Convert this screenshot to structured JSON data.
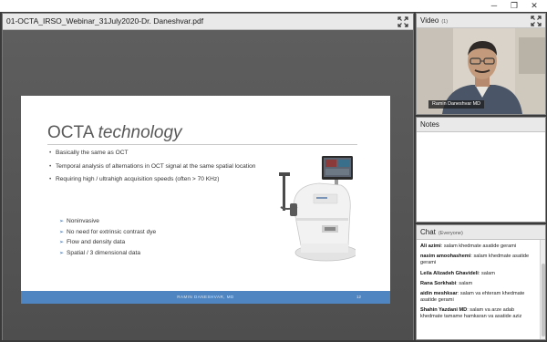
{
  "window": {
    "min_glyph": "─",
    "max_glyph": "❐",
    "close_glyph": "✕"
  },
  "document": {
    "title": "01-OCTA_IRSO_Webinar_31July2020-Dr. Daneshvar.pdf",
    "slide": {
      "title_plain": "OCTA ",
      "title_italic": "technology",
      "bullets": [
        "Basically the same as OCT",
        "Temporal analysis of alternations in OCT signal at the same spatial location",
        "Requiring high / ultrahigh acquisition speeds (often > 70 KHz)"
      ],
      "sub_bullets": [
        "Noninvasive",
        "No need for extrinsic contrast dye",
        "Flow and density data",
        "Spatial / 3 dimensional data"
      ],
      "footer_text": "RAMIN DANESHVAR, MD",
      "page_number": "12"
    }
  },
  "video": {
    "title": "Video",
    "count": "(1)",
    "speaker_name": "Ramin Daneshvar MD"
  },
  "notes": {
    "title": "Notes"
  },
  "chat": {
    "title": "Chat",
    "scope": "(Everyone)",
    "messages": [
      {
        "sender": "Ali azimi",
        "text": "salam khedmate asatide gerami"
      },
      {
        "sender": "nasim amoohashemi",
        "text": "salam khedmate asatide gerami"
      },
      {
        "sender": "Leila Alizadeh Ghavideli",
        "text": "salam"
      },
      {
        "sender": "Rana Sorkhabi",
        "text": "salam"
      },
      {
        "sender": "aidin meshksar",
        "text": "salam va ehteram khedmate asatide gerami"
      },
      {
        "sender": "Shahin Yazdani MD",
        "text": "salam va arze adab khedmate tamame hamkaran va asatide aziz"
      }
    ]
  },
  "colors": {
    "slide_footer": "#4f86c2",
    "panel_header": "#e9e9e9",
    "workspace": "#595959"
  },
  "icons": {
    "expand": "expand-arrows-icon"
  }
}
